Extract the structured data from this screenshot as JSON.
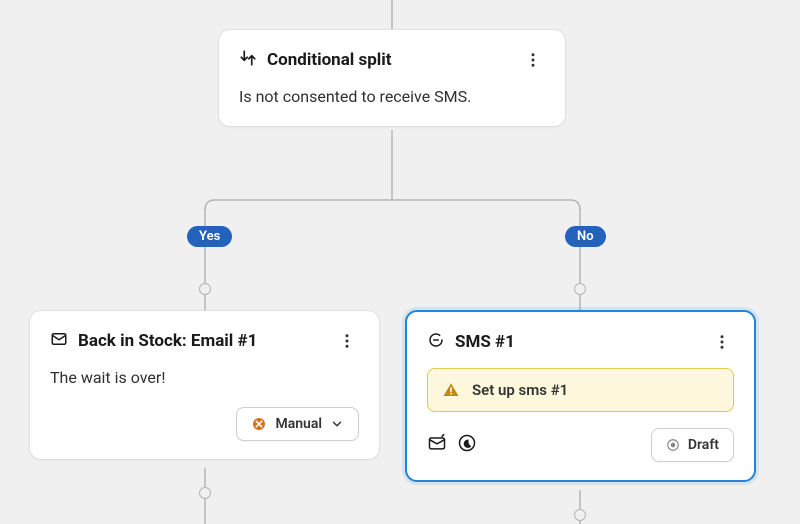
{
  "split": {
    "title": "Conditional split",
    "description": "Is not consented to receive SMS."
  },
  "branches": {
    "yes": {
      "label": "Yes"
    },
    "no": {
      "label": "No"
    }
  },
  "email_card": {
    "title": "Back in Stock: Email #1",
    "description": "The wait is over!",
    "action_label": "Manual"
  },
  "sms_card": {
    "title": "SMS #1",
    "alert": "Set up sms #1",
    "status_label": "Draft"
  }
}
